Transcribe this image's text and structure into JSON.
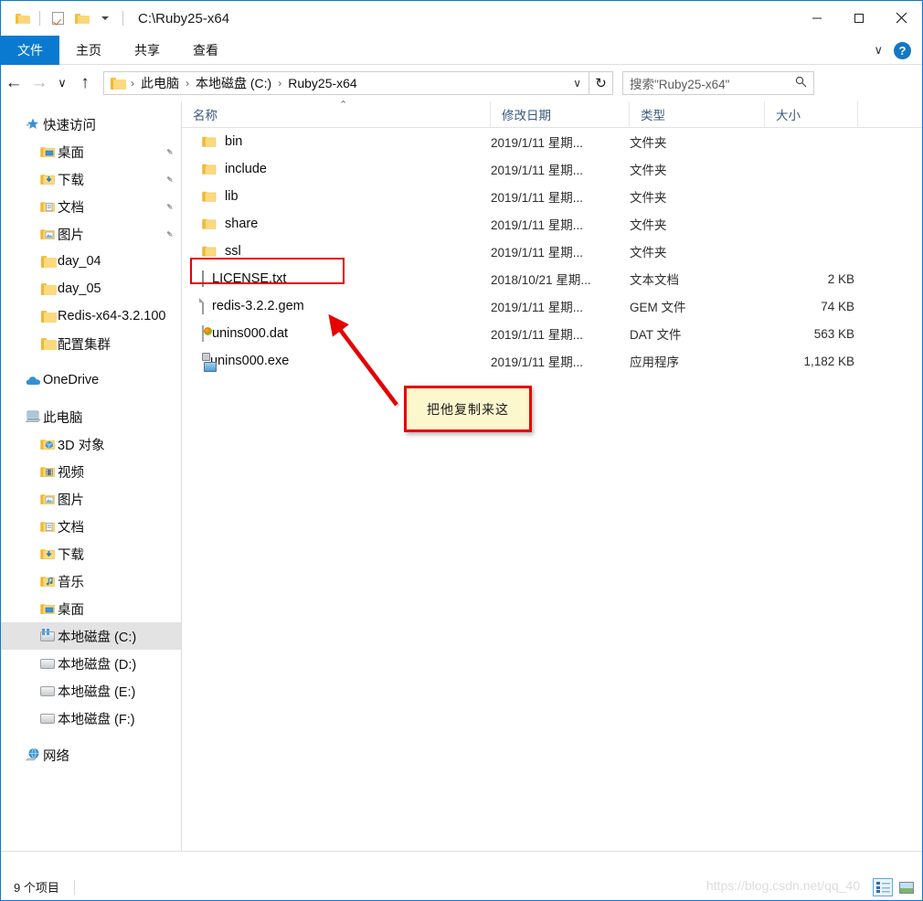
{
  "window": {
    "title_path": "C:\\Ruby25-x64",
    "quick_access": [
      {
        "name": "folder-icon",
        "label": ""
      },
      {
        "name": "properties-icon",
        "label": ""
      },
      {
        "name": "new-folder-icon",
        "label": ""
      },
      {
        "name": "customize-dropdown-icon",
        "label": ""
      }
    ],
    "controls": {
      "minimize": "—",
      "maximize": "□",
      "close": "✕"
    }
  },
  "ribbon": {
    "tabs": [
      {
        "label": "文件",
        "active": true
      },
      {
        "label": "主页",
        "active": false
      },
      {
        "label": "共享",
        "active": false
      },
      {
        "label": "查看",
        "active": false
      }
    ],
    "expand_label": "∨",
    "help_label": "?"
  },
  "addressbar": {
    "back": "←",
    "forward": "→",
    "recent": "∨",
    "up": "↑",
    "breadcrumbs": [
      "此电脑",
      "本地磁盘 (C:)",
      "Ruby25-x64"
    ],
    "separator": "›",
    "dropdown": "∨",
    "refresh": "↻",
    "search_value": "搜索\"Ruby25-x64\"",
    "search_placeholder": "搜索\"Ruby25-x64\""
  },
  "sidebar": {
    "items": [
      {
        "label": "快速访问",
        "icon": "star-icon",
        "level": 0,
        "pinned": false,
        "selected": false
      },
      {
        "label": "桌面",
        "icon": "folder-desktop-icon",
        "level": 1,
        "pinned": true,
        "selected": false
      },
      {
        "label": "下载",
        "icon": "folder-downloads-icon",
        "level": 1,
        "pinned": true,
        "selected": false
      },
      {
        "label": "文档",
        "icon": "folder-documents-icon",
        "level": 1,
        "pinned": true,
        "selected": false
      },
      {
        "label": "图片",
        "icon": "folder-pictures-icon",
        "level": 1,
        "pinned": true,
        "selected": false
      },
      {
        "label": "day_04",
        "icon": "folder-icon",
        "level": 1,
        "pinned": false,
        "selected": false
      },
      {
        "label": "day_05",
        "icon": "folder-icon",
        "level": 1,
        "pinned": false,
        "selected": false
      },
      {
        "label": "Redis-x64-3.2.100",
        "icon": "folder-icon",
        "level": 1,
        "pinned": false,
        "selected": false
      },
      {
        "label": "配置集群",
        "icon": "folder-icon",
        "level": 1,
        "pinned": false,
        "selected": false
      },
      {
        "label": "OneDrive",
        "icon": "cloud-icon",
        "level": 0,
        "pinned": false,
        "selected": false
      },
      {
        "label": "此电脑",
        "icon": "computer-icon",
        "level": 0,
        "pinned": false,
        "selected": false
      },
      {
        "label": "3D 对象",
        "icon": "folder-3d-icon",
        "level": 1,
        "pinned": false,
        "selected": false
      },
      {
        "label": "视频",
        "icon": "folder-videos-icon",
        "level": 1,
        "pinned": false,
        "selected": false
      },
      {
        "label": "图片",
        "icon": "folder-pictures-icon",
        "level": 1,
        "pinned": false,
        "selected": false
      },
      {
        "label": "文档",
        "icon": "folder-documents-icon",
        "level": 1,
        "pinned": false,
        "selected": false
      },
      {
        "label": "下载",
        "icon": "folder-downloads-icon",
        "level": 1,
        "pinned": false,
        "selected": false
      },
      {
        "label": "音乐",
        "icon": "folder-music-icon",
        "level": 1,
        "pinned": false,
        "selected": false
      },
      {
        "label": "桌面",
        "icon": "folder-desktop-icon",
        "level": 1,
        "pinned": false,
        "selected": false
      },
      {
        "label": "本地磁盘 (C:)",
        "icon": "drive-system-icon",
        "level": 1,
        "pinned": false,
        "selected": true
      },
      {
        "label": "本地磁盘 (D:)",
        "icon": "drive-icon",
        "level": 1,
        "pinned": false,
        "selected": false
      },
      {
        "label": "本地磁盘 (E:)",
        "icon": "drive-icon",
        "level": 1,
        "pinned": false,
        "selected": false
      },
      {
        "label": "本地磁盘 (F:)",
        "icon": "drive-icon",
        "level": 1,
        "pinned": false,
        "selected": false
      },
      {
        "label": "网络",
        "icon": "network-icon",
        "level": 0,
        "pinned": false,
        "selected": false
      }
    ]
  },
  "filelist": {
    "columns": [
      {
        "label": "名称",
        "sorted": "asc"
      },
      {
        "label": "修改日期",
        "sorted": ""
      },
      {
        "label": "类型",
        "sorted": ""
      },
      {
        "label": "大小",
        "sorted": ""
      }
    ],
    "sort_indicator": "⌃",
    "rows": [
      {
        "name": "bin",
        "icon": "folder-icon",
        "date": "2019/1/11 星期...",
        "type": "文件夹",
        "size": "",
        "highlighted": false
      },
      {
        "name": "include",
        "icon": "folder-icon",
        "date": "2019/1/11 星期...",
        "type": "文件夹",
        "size": "",
        "highlighted": false
      },
      {
        "name": "lib",
        "icon": "folder-icon",
        "date": "2019/1/11 星期...",
        "type": "文件夹",
        "size": "",
        "highlighted": false
      },
      {
        "name": "share",
        "icon": "folder-icon",
        "date": "2019/1/11 星期...",
        "type": "文件夹",
        "size": "",
        "highlighted": false
      },
      {
        "name": "ssl",
        "icon": "folder-icon",
        "date": "2019/1/11 星期...",
        "type": "文件夹",
        "size": "",
        "highlighted": false
      },
      {
        "name": "LICENSE.txt",
        "icon": "text-file-icon",
        "date": "2018/10/21 星期...",
        "type": "文本文档",
        "size": "2 KB",
        "highlighted": false
      },
      {
        "name": "redis-3.2.2.gem",
        "icon": "blank-file-icon",
        "date": "2019/1/11 星期...",
        "type": "GEM 文件",
        "size": "74 KB",
        "highlighted": true
      },
      {
        "name": "unins000.dat",
        "icon": "dat-file-icon",
        "date": "2019/1/11 星期...",
        "type": "DAT 文件",
        "size": "563 KB",
        "highlighted": false
      },
      {
        "name": "unins000.exe",
        "icon": "exe-file-icon",
        "date": "2019/1/11 星期...",
        "type": "应用程序",
        "size": "1,182 KB",
        "highlighted": false
      }
    ]
  },
  "annotation": {
    "callout_text": "把他复制来这",
    "box_color": "#e60000",
    "box_fill": "#fbf8cd",
    "arrow_color": "#e60000"
  },
  "statusbar": {
    "item_count": "9 个项目",
    "watermark": "https://blog.csdn.net/qq_40",
    "view_details": "details-view-button",
    "view_thumbnails": "thumbnail-view-button"
  }
}
